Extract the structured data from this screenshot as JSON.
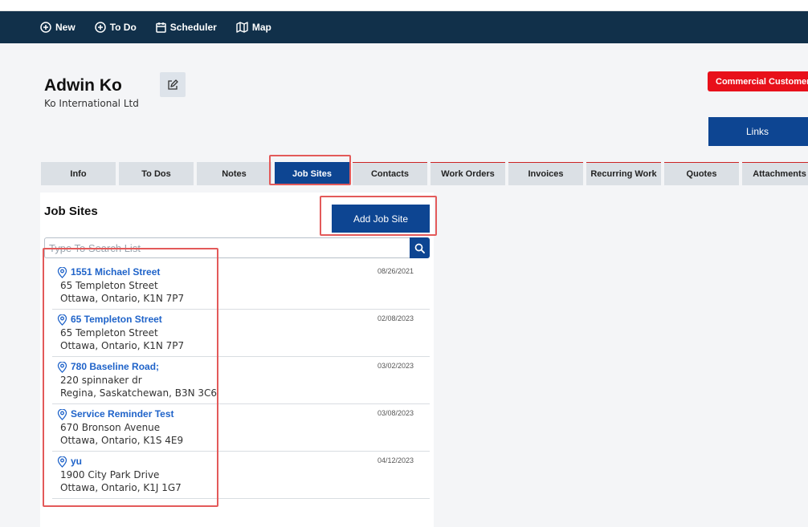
{
  "nav": {
    "items": [
      {
        "label": "New",
        "icon": "plus-circle-icon"
      },
      {
        "label": "To Do",
        "icon": "plus-circle-icon"
      },
      {
        "label": "Scheduler",
        "icon": "calendar-icon"
      },
      {
        "label": "Map",
        "icon": "map-icon"
      }
    ]
  },
  "customer": {
    "name": "Adwin Ko",
    "company": "Ko International Ltd",
    "badge": "Commercial Customer",
    "links_label": "Links"
  },
  "tabs": [
    {
      "label": "Info"
    },
    {
      "label": "To Dos"
    },
    {
      "label": "Notes"
    },
    {
      "label": "Job Sites",
      "active": true
    },
    {
      "label": "Contacts"
    },
    {
      "label": "Work Orders"
    },
    {
      "label": "Invoices"
    },
    {
      "label": "Recurring Work"
    },
    {
      "label": "Quotes"
    },
    {
      "label": "Attachments"
    }
  ],
  "job_sites": {
    "title": "Job Sites",
    "add_label": "Add Job Site",
    "search_placeholder": "Type To Search List",
    "items": [
      {
        "name": "1551 Michael Street",
        "line1": "65 Templeton Street",
        "line2": "Ottawa, Ontario, K1N 7P7",
        "date": "08/26/2021"
      },
      {
        "name": "65 Templeton Street",
        "line1": "65 Templeton Street",
        "line2": "Ottawa, Ontario, K1N 7P7",
        "date": "02/08/2023"
      },
      {
        "name": "780 Baseline Road;",
        "line1": "220 spinnaker dr",
        "line2": "Regina, Saskatchewan, B3N 3C6",
        "date": "03/02/2023"
      },
      {
        "name": "Service Reminder Test",
        "line1": "670 Bronson Avenue",
        "line2": "Ottawa, Ontario, K1S 4E9",
        "date": "03/08/2023"
      },
      {
        "name": "yu",
        "line1": "1900 City Park Drive",
        "line2": "Ottawa, Ontario, K1J 1G7",
        "date": "04/12/2023"
      }
    ]
  },
  "colors": {
    "navbar": "#11304a",
    "primary": "#0d4592",
    "badge": "#e8101a",
    "link": "#1f63c9",
    "highlight": "#e35a5a"
  }
}
